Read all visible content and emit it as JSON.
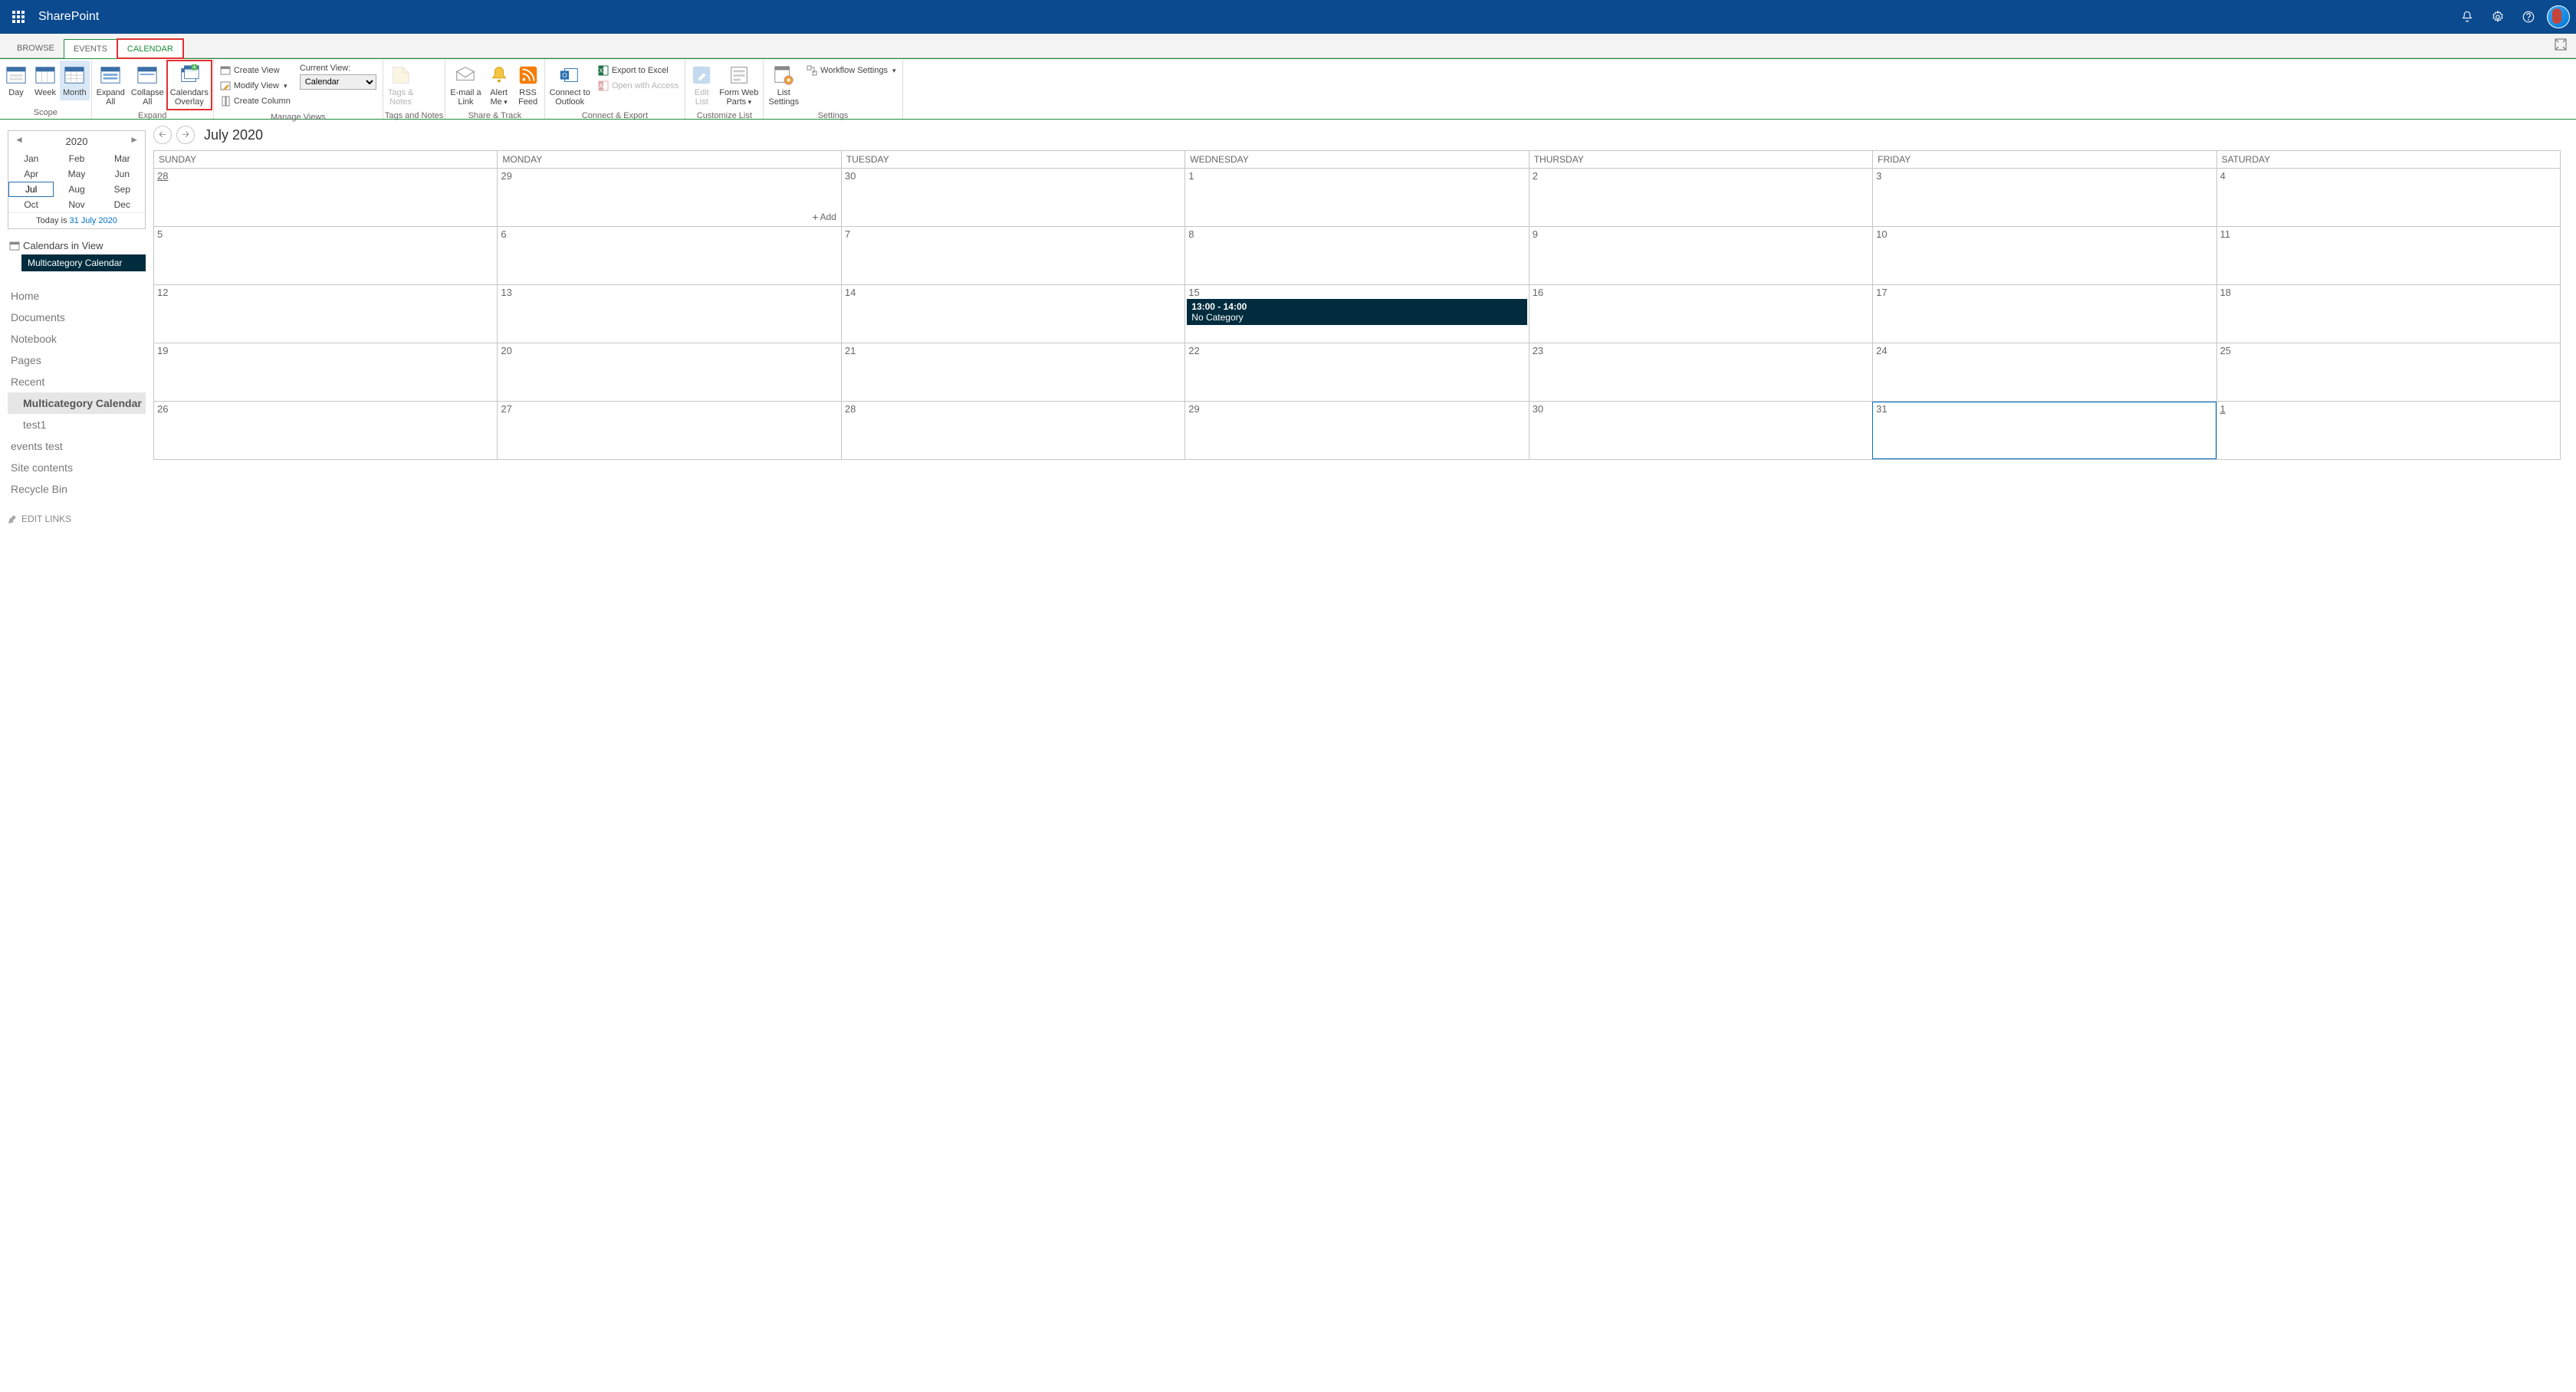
{
  "suite": {
    "title": "SharePoint"
  },
  "tabs": {
    "browse": "BROWSE",
    "events": "EVENTS",
    "calendar": "CALENDAR"
  },
  "ribbon": {
    "scope": {
      "label": "Scope",
      "day": "Day",
      "week": "Week",
      "month": "Month"
    },
    "expand": {
      "label": "Expand",
      "expand_all": "Expand All",
      "collapse_all": "Collapse All",
      "overlay": "Calendars Overlay"
    },
    "manage": {
      "label": "Manage Views",
      "create_view": "Create View",
      "modify_view": "Modify View",
      "create_column": "Create Column",
      "current_view_label": "Current View:",
      "current_view_value": "Calendar"
    },
    "tags": {
      "label": "Tags and Notes",
      "tags_notes": "Tags & Notes"
    },
    "share": {
      "label": "Share & Track",
      "email": "E-mail a Link",
      "alert": "Alert Me",
      "rss": "RSS Feed"
    },
    "connect": {
      "label": "Connect & Export",
      "outlook": "Connect to Outlook",
      "excel": "Export to Excel",
      "access": "Open with Access"
    },
    "customize": {
      "label": "Customize List",
      "edit_list": "Edit List",
      "form_web": "Form Web Parts"
    },
    "settings": {
      "label": "Settings",
      "list_settings": "List Settings",
      "workflow": "Workflow Settings"
    }
  },
  "datepicker": {
    "year": "2020",
    "months": [
      "Jan",
      "Feb",
      "Mar",
      "Apr",
      "May",
      "Jun",
      "Jul",
      "Aug",
      "Sep",
      "Oct",
      "Nov",
      "Dec"
    ],
    "selected": "Jul",
    "today_prefix": "Today is ",
    "today_date": "31 July 2020"
  },
  "calendars_in_view": {
    "title": "Calendars in View",
    "items": [
      "Multicategory Calendar"
    ]
  },
  "quicklaunch": {
    "items": [
      {
        "label": "Home",
        "indent": false,
        "sel": false
      },
      {
        "label": "Documents",
        "indent": false,
        "sel": false
      },
      {
        "label": "Notebook",
        "indent": false,
        "sel": false
      },
      {
        "label": "Pages",
        "indent": false,
        "sel": false
      },
      {
        "label": "Recent",
        "indent": false,
        "sel": false
      },
      {
        "label": "Multicategory Calendar",
        "indent": true,
        "sel": true
      },
      {
        "label": "test1",
        "indent": true,
        "sel": false
      },
      {
        "label": "events test",
        "indent": false,
        "sel": false
      },
      {
        "label": "Site contents",
        "indent": false,
        "sel": false
      },
      {
        "label": "Recycle Bin",
        "indent": false,
        "sel": false
      }
    ],
    "edit_links": "EDIT LINKS"
  },
  "calendar": {
    "title": "July 2020",
    "dow": [
      "SUNDAY",
      "MONDAY",
      "TUESDAY",
      "WEDNESDAY",
      "THURSDAY",
      "FRIDAY",
      "SATURDAY"
    ],
    "add_label": "Add",
    "weeks": [
      {
        "days": [
          {
            "n": "28",
            "other": true,
            "add": false
          },
          {
            "n": "29",
            "other": false,
            "add": true
          },
          {
            "n": "30",
            "other": false
          },
          {
            "n": "1",
            "other": false
          },
          {
            "n": "2",
            "other": false
          },
          {
            "n": "3",
            "other": false
          },
          {
            "n": "4",
            "other": false
          }
        ]
      },
      {
        "days": [
          {
            "n": "5"
          },
          {
            "n": "6"
          },
          {
            "n": "7"
          },
          {
            "n": "8"
          },
          {
            "n": "9"
          },
          {
            "n": "10"
          },
          {
            "n": "11"
          }
        ]
      },
      {
        "days": [
          {
            "n": "12"
          },
          {
            "n": "13"
          },
          {
            "n": "14"
          },
          {
            "n": "15",
            "event": true
          },
          {
            "n": "16"
          },
          {
            "n": "17"
          },
          {
            "n": "18"
          }
        ]
      },
      {
        "days": [
          {
            "n": "19"
          },
          {
            "n": "20"
          },
          {
            "n": "21"
          },
          {
            "n": "22"
          },
          {
            "n": "23"
          },
          {
            "n": "24"
          },
          {
            "n": "25"
          }
        ]
      },
      {
        "days": [
          {
            "n": "26"
          },
          {
            "n": "27"
          },
          {
            "n": "28"
          },
          {
            "n": "29"
          },
          {
            "n": "30"
          },
          {
            "n": "31",
            "today": true
          },
          {
            "n": "1",
            "other": true
          }
        ]
      }
    ],
    "event": {
      "time": "13:00 - 14:00",
      "title": "No Category"
    }
  }
}
